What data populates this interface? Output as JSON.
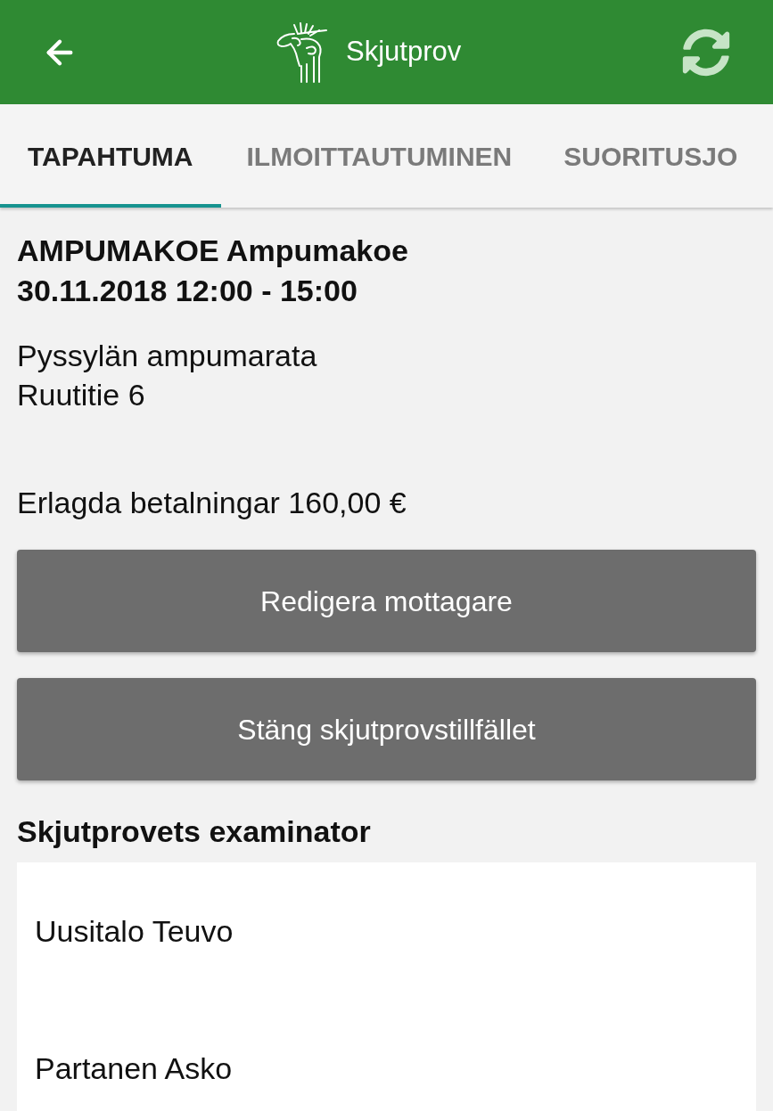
{
  "app_bar": {
    "title": "Skjutprov"
  },
  "tabs": [
    {
      "label": "TAPAHTUMA",
      "selected": true
    },
    {
      "label": "ILMOITTAUTUMINEN",
      "selected": false
    },
    {
      "label": "SUORITUSJO",
      "selected": false
    }
  ],
  "event": {
    "title_lines": [
      "AMPUMAKOE Ampumakoe",
      "30.11.2018 12:00 - 15:00"
    ],
    "address_lines": [
      "Pyssylän ampumarata",
      "Ruutitie 6"
    ],
    "payments": "Erlagda betalningar 160,00 €"
  },
  "buttons": [
    "Redigera mottagare",
    "Stäng skjutprovstillfället"
  ],
  "examiners": {
    "heading": "Skjutprovets examinator",
    "items": [
      "Uusitalo Teuvo",
      "Partanen Asko"
    ]
  }
}
